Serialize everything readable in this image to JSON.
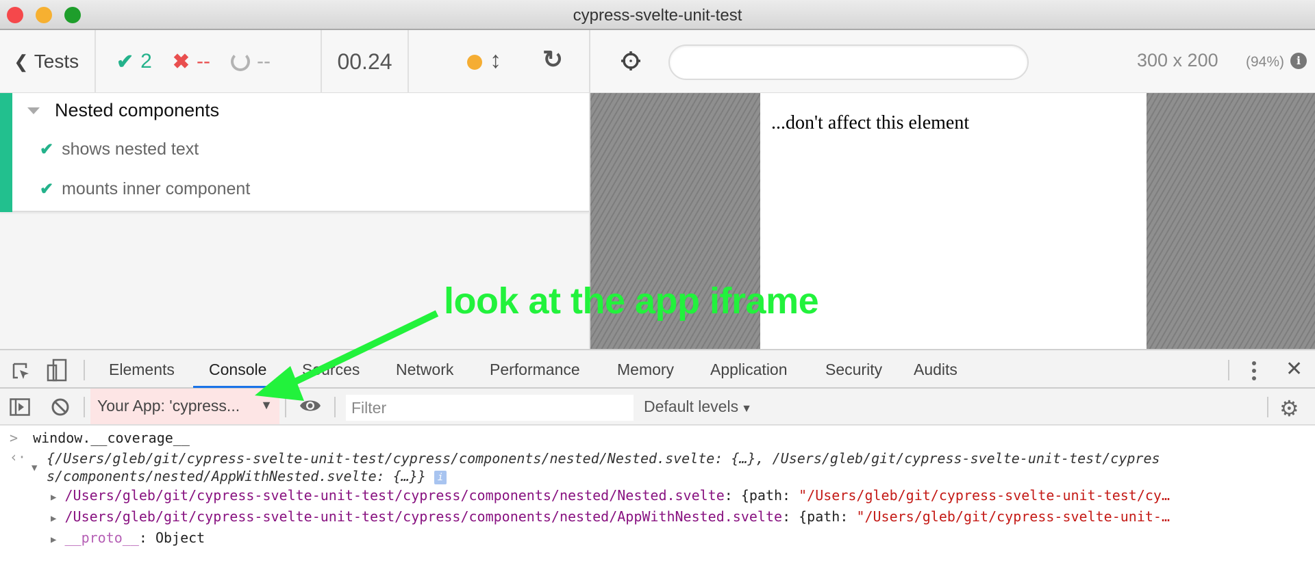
{
  "window": {
    "title": "cypress-svelte-unit-test"
  },
  "reporter": {
    "back_label": "Tests",
    "stats": {
      "passed": "2",
      "failed": "--",
      "pending": "--"
    },
    "duration": "00.24",
    "suite": {
      "title": "Nested components",
      "tests": [
        {
          "title": "shows nested text",
          "state": "passed"
        },
        {
          "title": "mounts inner component",
          "state": "passed"
        }
      ]
    }
  },
  "aut": {
    "url": "",
    "viewport_size": "300 x 200",
    "viewport_scale": "(94%)",
    "frame_text": "...don't affect this element"
  },
  "annotation": {
    "text": "look at the app iframe",
    "color": "#22f23c"
  },
  "devtools": {
    "tabs": [
      {
        "label": "Elements",
        "active": false
      },
      {
        "label": "Console",
        "active": true
      },
      {
        "label": "Sources",
        "active": false
      },
      {
        "label": "Network",
        "active": false
      },
      {
        "label": "Performance",
        "active": false
      },
      {
        "label": "Memory",
        "active": false
      },
      {
        "label": "Application",
        "active": false
      },
      {
        "label": "Security",
        "active": false
      },
      {
        "label": "Audits",
        "active": false
      }
    ],
    "context": "Your App: 'cypress...",
    "filter_placeholder": "Filter",
    "filter_value": "",
    "levels": "Default levels",
    "console": {
      "input": "window.__coverage__",
      "result_line1": "{/Users/gleb/git/cypress-svelte-unit-test/cypress/components/nested/Nested.svelte: {…}, /Users/gleb/git/cypress-svelte-unit-test/cypres",
      "result_line2": "s/components/nested/AppWithNested.svelte: {…}}",
      "entries": [
        {
          "key": "/Users/gleb/git/cypress-svelte-unit-test/cypress/components/nested/Nested.svelte",
          "sep": ": {path: ",
          "value": "\"/Users/gleb/git/cypress-svelte-unit-test/cy…"
        },
        {
          "key": "/Users/gleb/git/cypress-svelte-unit-test/cypress/components/nested/AppWithNested.svelte",
          "sep": ": {path: ",
          "value": "\"/Users/gleb/git/cypress-svelte-unit-…"
        }
      ],
      "proto_key": "__proto__",
      "proto_value": ": Object"
    }
  }
}
